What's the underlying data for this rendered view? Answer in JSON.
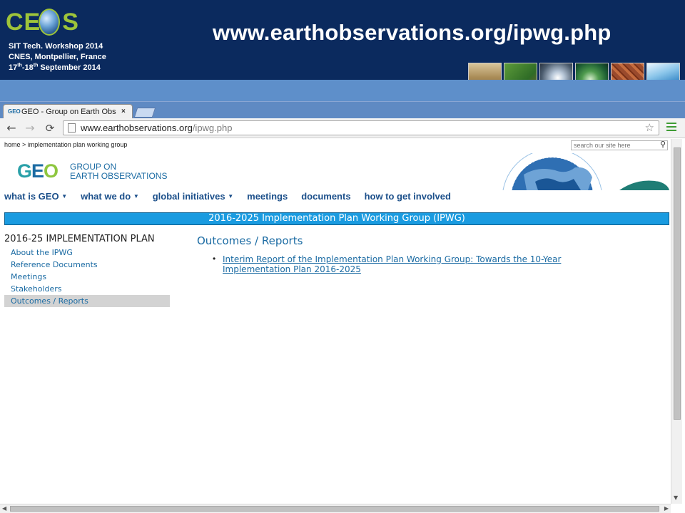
{
  "slide": {
    "logo_text_left": "CE",
    "logo_text_right": "S",
    "workshop_line1": "SIT Tech. Workshop 2014",
    "workshop_line2": "CNES, Montpellier, France",
    "workshop_line3_day1": "17",
    "workshop_line3_sup1": "th",
    "workshop_line3_sep": "-18",
    "workshop_line3_sup2": "th",
    "workshop_line3_rest": " September 2014",
    "url_title": "www.earthobservations.org/ipwg.php",
    "header_color": "#0b2a5e",
    "band_color": "#5e8fca"
  },
  "browser": {
    "tab_title": "GEO - Group on Earth Obs",
    "tab_favicon": "GEO",
    "tab_close": "×",
    "back_icon": "←",
    "forward_icon": "→",
    "reload_icon": "⟳",
    "url_host": "www.earthobservations.org",
    "url_path": "/ipwg.php",
    "star_icon": "☆"
  },
  "page": {
    "breadcrumb": "home > implementation plan working group",
    "search_placeholder": "search our site here",
    "logo": {
      "mark_g": "G",
      "mark_e": "E",
      "mark_o": "O",
      "name_line1": "GROUP ON",
      "name_line2": "EARTH OBSERVATIONS"
    },
    "nav": [
      {
        "label": "what is GEO",
        "caret": "▼"
      },
      {
        "label": "what we do",
        "caret": "▼"
      },
      {
        "label": "global initiatives",
        "caret": "▼"
      },
      {
        "label": "meetings"
      },
      {
        "label": "documents"
      },
      {
        "label": "how to get involved"
      }
    ],
    "section_title": "2016-2025 Implementation Plan Working Group (IPWG)",
    "sidebar": {
      "title": "2016-25 Implementation Plan",
      "items": [
        "About the IPWG",
        "Reference Documents",
        "Meetings",
        "Stakeholders",
        "Outcomes / Reports"
      ],
      "active": "Outcomes / Reports"
    },
    "content": {
      "title": "Outcomes / Reports",
      "report_line1": "Interim Report of the Implementation Plan Working Group: Towards the 10-Year",
      "report_line2": "Implementation Plan 2016-2025"
    },
    "accent_color": "#1a9be0",
    "link_color": "#1b6ba3"
  }
}
